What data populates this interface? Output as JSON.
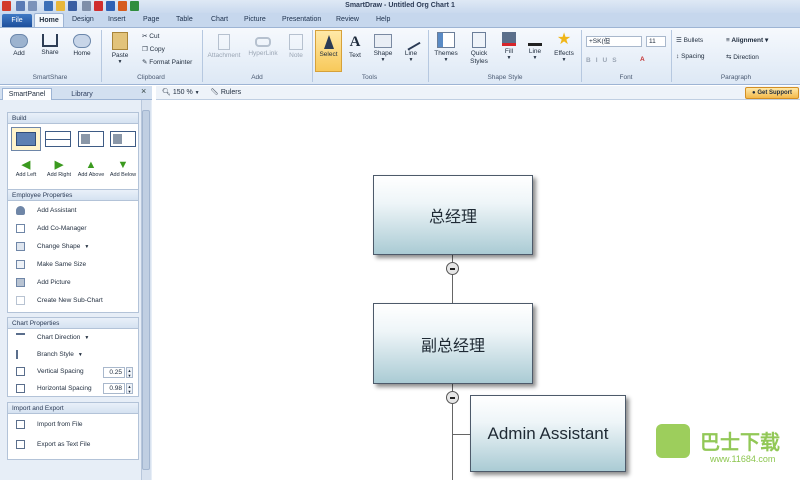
{
  "app_title": "SmartDraw - Untitled Org Chart 1",
  "tabs": [
    "File",
    "Home",
    "Design",
    "Insert",
    "Page",
    "Table",
    "Chart",
    "Picture",
    "Presentation",
    "Review",
    "Help"
  ],
  "ribbon": {
    "smartshare": {
      "label": "SmartShare",
      "add": "Add",
      "share": "Share",
      "home": "Home"
    },
    "clipboard": {
      "label": "Clipboard",
      "paste": "Paste",
      "cut": "Cut",
      "copy": "Copy",
      "format_painter": "Format Painter"
    },
    "add": {
      "label": "Add",
      "attachment": "Attachment",
      "hyperlink": "HyperLink",
      "note": "Note"
    },
    "tools": {
      "label": "Tools",
      "select": "Select",
      "text": "Text",
      "shape": "Shape",
      "line": "Line"
    },
    "shape_style": {
      "label": "Shape Style",
      "themes": "Themes",
      "quick_styles": "Quick Styles",
      "fill": "Fill",
      "line": "Line",
      "effects": "Effects"
    },
    "font": {
      "label": "Font",
      "font_name": "+SK(但",
      "font_size": "11"
    },
    "paragraph": {
      "label": "Paragraph",
      "bullets": "Bullets",
      "alignment": "Alignment",
      "spacing": "Spacing",
      "direction": "Direction"
    }
  },
  "panel": {
    "tab_smartpanel": "SmartPanel",
    "tab_library": "Library",
    "build": {
      "title": "Build",
      "add_left": "Add Left",
      "add_right": "Add Right",
      "add_above": "Add Above",
      "add_below": "Add Below"
    },
    "employee": {
      "title": "Employee Properties",
      "items": [
        "Add Assistant",
        "Add Co-Manager",
        "Change Shape",
        "Make Same Size",
        "Add Picture",
        "Create New Sub-Chart"
      ]
    },
    "chart": {
      "title": "Chart Properties",
      "direction": "Chart Direction",
      "branch": "Branch Style",
      "vertical": "Vertical Spacing",
      "vertical_val": "0.25",
      "horizontal": "Horizontal Spacing",
      "horizontal_val": "0.98"
    },
    "import": {
      "title": "Import and Export",
      "import_file": "Import from File",
      "export_text": "Export as Text File"
    }
  },
  "canvas_toolbar": {
    "zoom": "150 %",
    "rulers": "Rulers",
    "get_support": "Get Support"
  },
  "chart": {
    "node1": "总经理",
    "node2": "副总经理",
    "node3": "Admin Assistant"
  },
  "watermark": {
    "text": "巴士下载",
    "url": "www.11684.com"
  },
  "colors": {
    "ribbon_bg": "#dde8f5",
    "file_tab": "#1d4f9c",
    "node_fill": "#aacbd4",
    "support": "#f3b94a"
  }
}
